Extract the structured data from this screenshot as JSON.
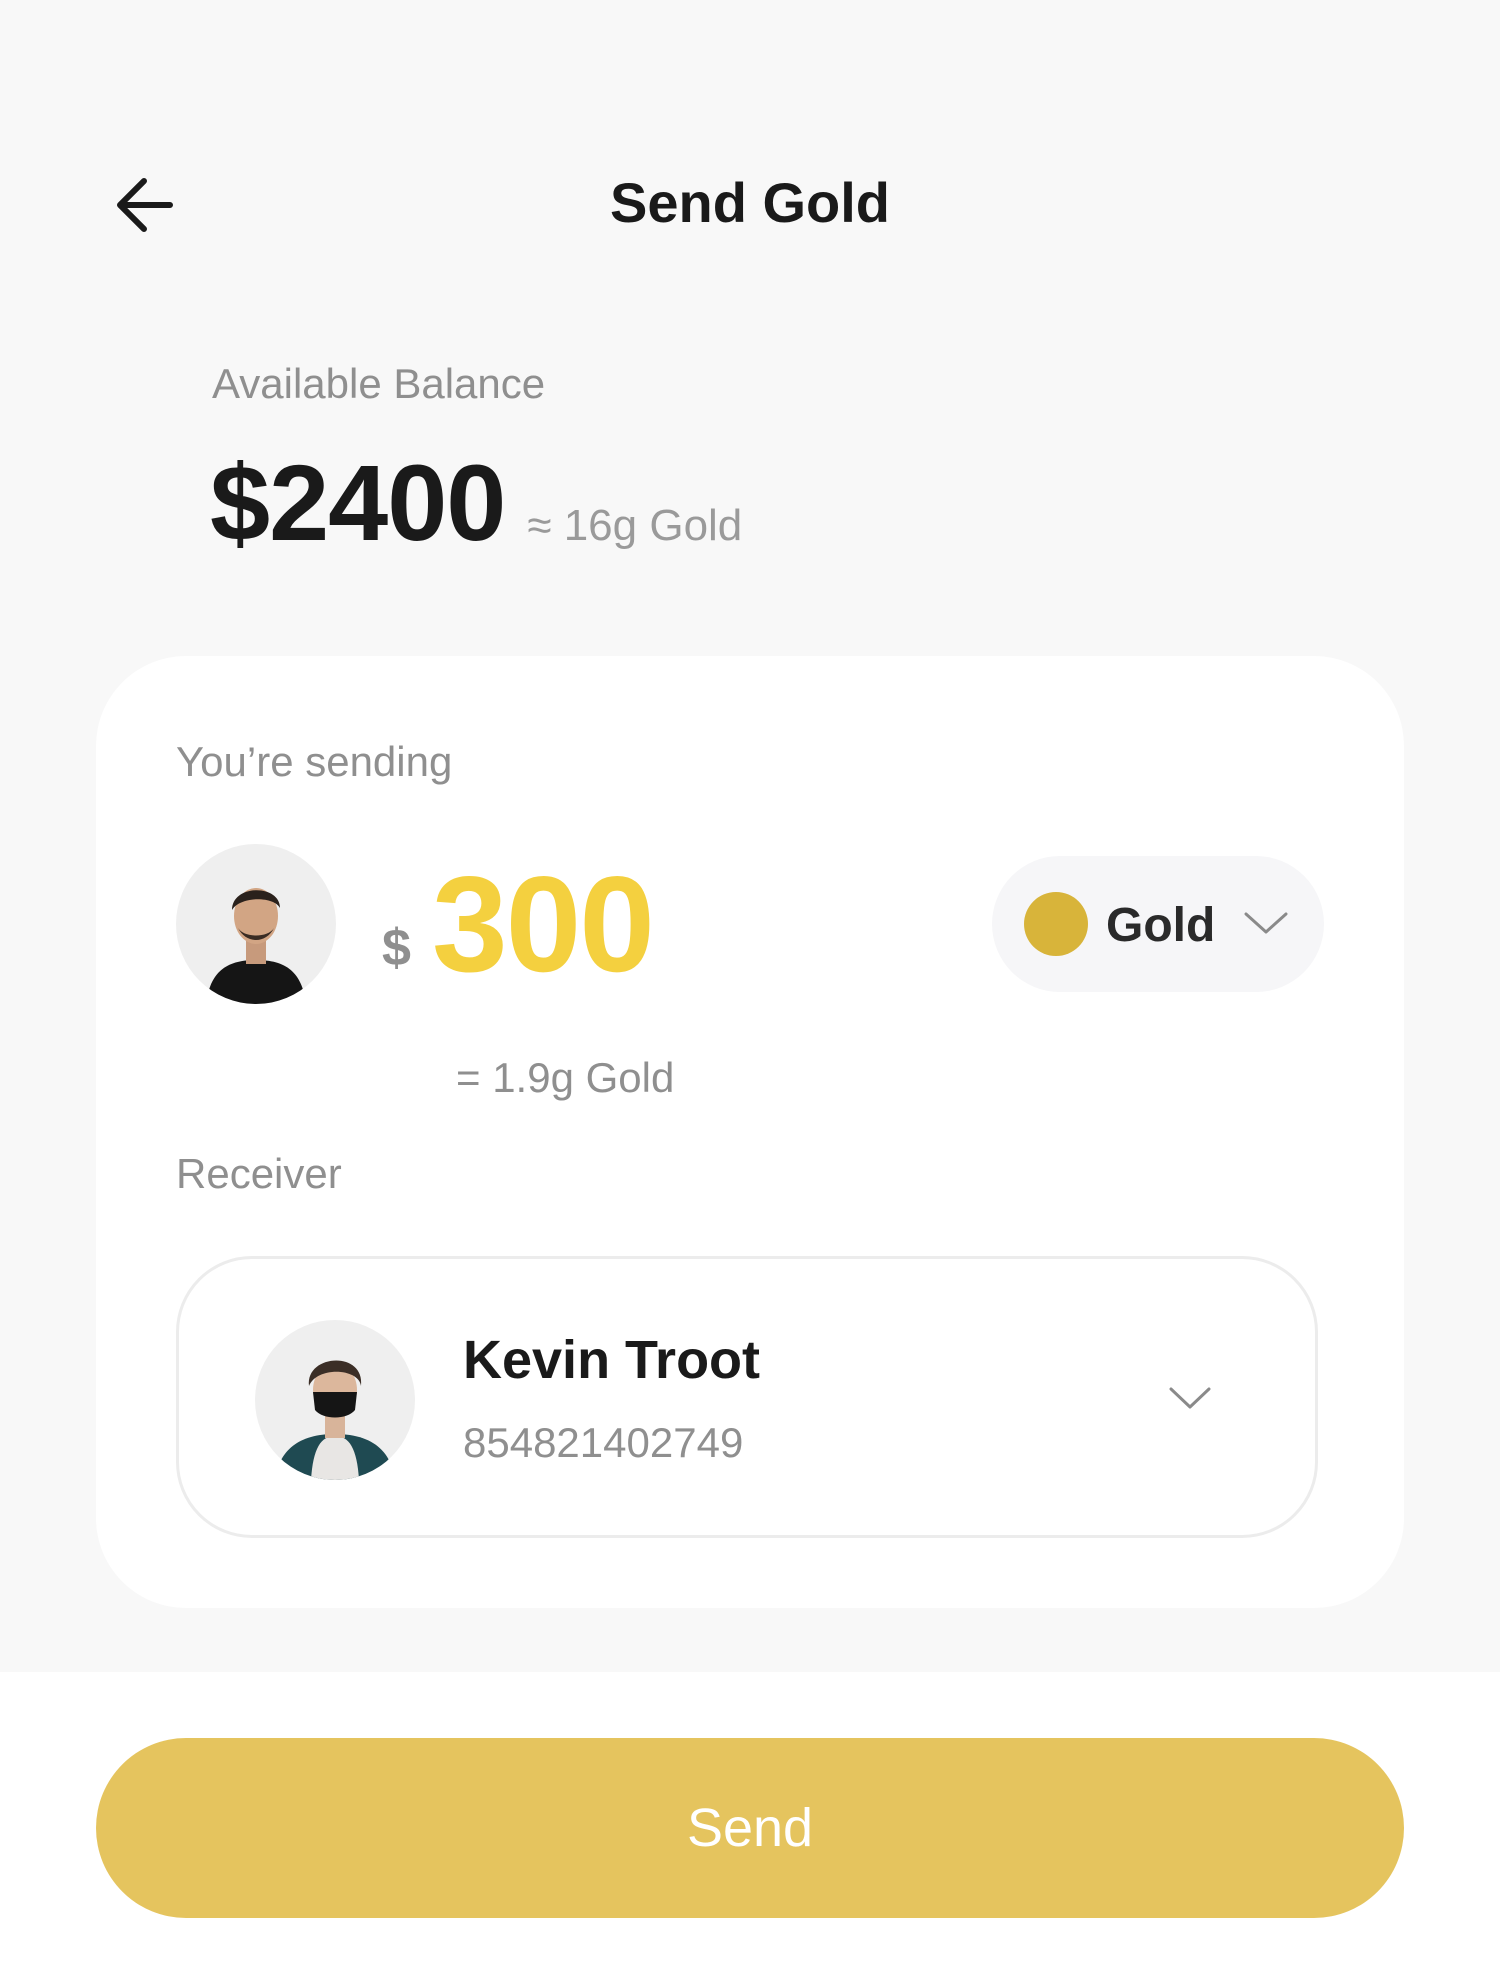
{
  "header": {
    "title": "Send Gold",
    "back_icon": "arrow-left-icon"
  },
  "balance": {
    "label": "Available Balance",
    "amount": "$2400",
    "approx": "≈ 16g Gold"
  },
  "sending": {
    "label": "You’re sending",
    "currency_symbol": "$",
    "amount": "300",
    "converted": "= 1.9g Gold",
    "asset": {
      "label": "Gold",
      "color": "#d8b43a",
      "chevron_icon": "chevron-down-icon"
    }
  },
  "receiver": {
    "label": "Receiver",
    "name": "Kevin Troot",
    "account": "854821402749",
    "chevron_icon": "chevron-down-icon"
  },
  "actions": {
    "send_label": "Send"
  },
  "colors": {
    "accent": "#f4d03f",
    "button": "#e5c45e",
    "muted_text": "#8f8f8f",
    "background": "#f8f8f8"
  }
}
